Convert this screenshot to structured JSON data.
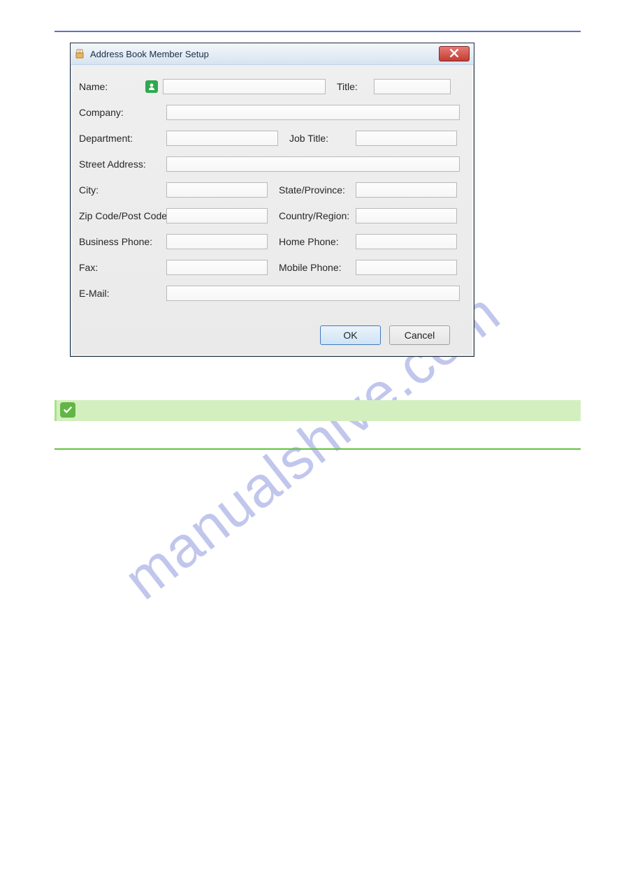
{
  "watermark": "manualshive.com",
  "dialog": {
    "title": "Address Book Member Setup",
    "labels": {
      "name": "Name:",
      "title": "Title:",
      "company": "Company:",
      "department": "Department:",
      "job_title": "Job Title:",
      "street": "Street Address:",
      "city": "City:",
      "state": "State/Province:",
      "zip": "Zip Code/Post Code:",
      "country": "Country/Region:",
      "bphone": "Business Phone:",
      "hphone": "Home Phone:",
      "fax": "Fax:",
      "mphone": "Mobile Phone:",
      "email": "E-Mail:"
    },
    "values": {
      "name": "",
      "title": "",
      "company": "",
      "department": "",
      "job_title": "",
      "street": "",
      "city": "",
      "state": "",
      "zip": "",
      "country": "",
      "bphone": "",
      "hphone": "",
      "fax": "",
      "mphone": "",
      "email": ""
    },
    "buttons": {
      "ok": "OK",
      "cancel": "Cancel"
    }
  }
}
